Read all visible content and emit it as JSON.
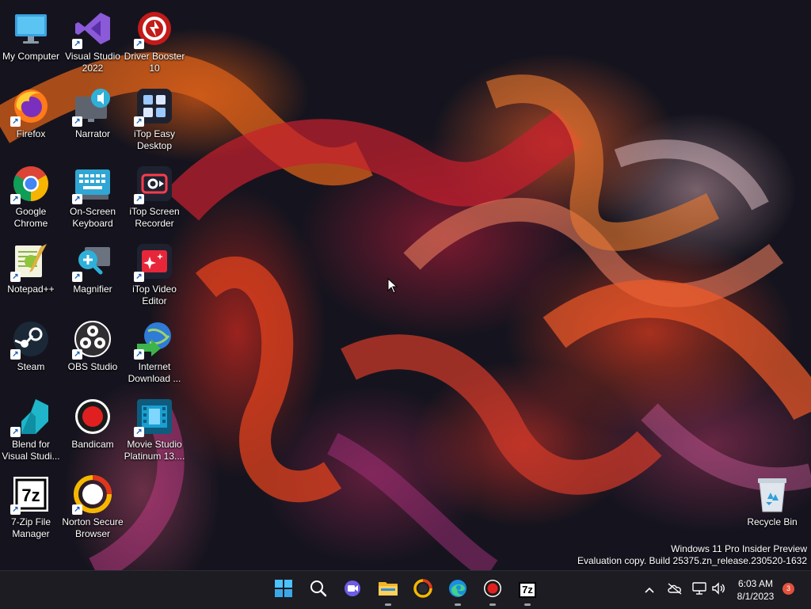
{
  "desktop_icons": [
    {
      "label": "My Computer",
      "icon": "monitor-icon"
    },
    {
      "label": "Visual Studio 2022",
      "icon": "visual-studio-icon"
    },
    {
      "label": "Driver Booster 10",
      "icon": "driver-booster-icon"
    },
    {
      "label": "Firefox",
      "icon": "firefox-icon"
    },
    {
      "label": "Narrator",
      "icon": "narrator-icon"
    },
    {
      "label": "iTop Easy Desktop",
      "icon": "itop-easy-desktop-icon"
    },
    {
      "label": "Google Chrome",
      "icon": "chrome-icon"
    },
    {
      "label": "On-Screen Keyboard",
      "icon": "keyboard-icon"
    },
    {
      "label": "iTop Screen Recorder",
      "icon": "itop-screen-recorder-icon"
    },
    {
      "label": "Notepad++",
      "icon": "notepadpp-icon"
    },
    {
      "label": "Magnifier",
      "icon": "magnifier-icon"
    },
    {
      "label": "iTop Video Editor",
      "icon": "itop-video-editor-icon"
    },
    {
      "label": "Steam",
      "icon": "steam-icon"
    },
    {
      "label": "OBS Studio",
      "icon": "obs-icon"
    },
    {
      "label": "Internet Download ...",
      "icon": "idm-icon"
    },
    {
      "label": "Blend for Visual Studi...",
      "icon": "blend-icon"
    },
    {
      "label": "Bandicam",
      "icon": "bandicam-icon"
    },
    {
      "label": "Movie Studio Platinum 13....",
      "icon": "movie-studio-icon"
    },
    {
      "label": "7-Zip File Manager",
      "icon": "7zip-icon"
    },
    {
      "label": "Norton Secure Browser",
      "icon": "norton-browser-icon"
    },
    {
      "label": "Recycle Bin",
      "icon": "recycle-bin-icon"
    }
  ],
  "watermark": {
    "line1": "Windows 11 Pro Insider Preview",
    "line2": "Evaluation copy. Build 25375.zn_release.230520-1632"
  },
  "taskbar": {
    "apps": [
      {
        "name": "start",
        "icon": "windows-start-icon"
      },
      {
        "name": "search",
        "icon": "search-icon"
      },
      {
        "name": "meet",
        "icon": "video-call-icon"
      },
      {
        "name": "file-explorer",
        "icon": "folder-icon"
      },
      {
        "name": "norton-browser",
        "icon": "norton-browser-icon"
      },
      {
        "name": "edge",
        "icon": "edge-icon"
      },
      {
        "name": "bandicam",
        "icon": "bandicam-icon"
      },
      {
        "name": "7zip",
        "icon": "7zip-icon"
      }
    ],
    "seven_zip_text": "7z",
    "clock_time": "6:03 AM",
    "clock_date": "8/1/2023",
    "notification_count": "3",
    "tray_icons": [
      "chevron-up-icon",
      "cloud-off-icon",
      "network-icon",
      "speaker-icon"
    ]
  },
  "icon_text": {
    "seven_zip": "7z"
  }
}
